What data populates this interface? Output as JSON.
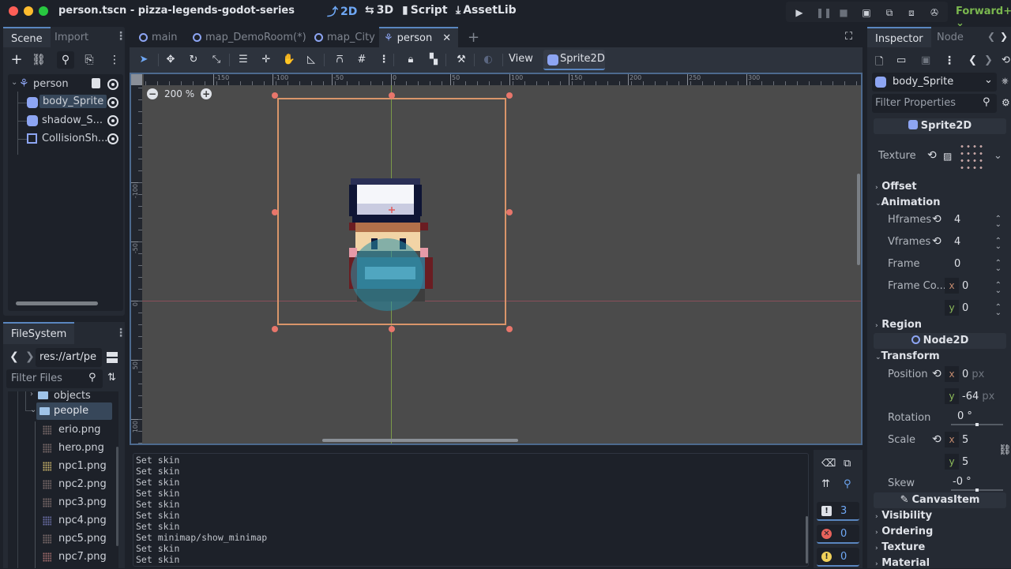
{
  "window": {
    "title": "person.tscn - pizza-legends-godot-series",
    "traffic_lights": [
      "#ff5f57",
      "#febc2e",
      "#28c840"
    ]
  },
  "workspaces": [
    {
      "label": "2D",
      "icon": "2d-icon",
      "active": true
    },
    {
      "label": "3D",
      "icon": "3d-icon",
      "active": false
    },
    {
      "label": "Script",
      "icon": "script-icon",
      "active": false
    },
    {
      "label": "AssetLib",
      "icon": "download-icon",
      "active": false
    }
  ],
  "run_bar": {
    "buttons": [
      "play",
      "pause",
      "stop",
      "remote-debug",
      "run-current-scene",
      "run-specific-scene",
      "movie-maker"
    ],
    "renderer": "Forward+"
  },
  "scene_dock": {
    "tabs": [
      "Scene",
      "Import"
    ],
    "active_tab": "Scene",
    "tree": [
      {
        "label": "person",
        "type": "Node2D",
        "depth": 0,
        "has_script": true
      },
      {
        "label": "body_Sprite",
        "type": "Sprite2D",
        "depth": 1,
        "selected": true
      },
      {
        "label": "shadow_S...",
        "type": "Sprite2D",
        "depth": 1
      },
      {
        "label": "CollisionSh...",
        "type": "CollisionShape2D",
        "depth": 1
      }
    ]
  },
  "filesystem": {
    "tab": "FileSystem",
    "path": "res://art/pe",
    "filter_placeholder": "Filter Files",
    "folders": [
      {
        "label": "objects",
        "expanded": false
      },
      {
        "label": "people",
        "expanded": true,
        "selected": true
      }
    ],
    "files": [
      "erio.png",
      "hero.png",
      "npc1.png",
      "npc2.png",
      "npc3.png",
      "npc4.png",
      "npc5.png",
      "npc7.png"
    ]
  },
  "scene_tabs": [
    {
      "label": "main",
      "active": false
    },
    {
      "label": "map_DemoRoom(*)",
      "active": false
    },
    {
      "label": "map_City",
      "active": false
    },
    {
      "label": "person",
      "active": true,
      "closable": true
    }
  ],
  "viewport_toolbar": {
    "view_label": "View",
    "node_menu_label": "Sprite2D"
  },
  "viewport": {
    "zoom": "200 %",
    "h_ruler_labels": [
      "-150",
      "-100",
      "-50",
      "0",
      "50",
      "100",
      "150",
      "200",
      "250",
      "300"
    ],
    "v_ruler_labels": [
      "-100",
      "-50",
      "0",
      "50",
      "100"
    ]
  },
  "output": {
    "lines": [
      "Set skin",
      "Set skin",
      "Set skin",
      "Set skin",
      "Set skin",
      "Set skin",
      "Set skin",
      "Set minimap/show_minimap",
      "Set skin",
      "Set skin"
    ],
    "counts": {
      "messages": "3",
      "errors": "0",
      "warnings": "0"
    }
  },
  "inspector": {
    "tabs": [
      "Inspector",
      "Node"
    ],
    "active_tab": "Inspector",
    "object_name": "body_Sprite",
    "filter_placeholder": "Filter Properties",
    "class_sprite": "Sprite2D",
    "texture_label": "Texture",
    "groups": {
      "offset": "Offset",
      "animation": "Animation",
      "region": "Region",
      "transform": "Transform",
      "visibility": "Visibility",
      "ordering": "Ordering",
      "texture": "Texture",
      "material": "Material"
    },
    "animation": {
      "hframes_label": "Hframes",
      "hframes": "4",
      "vframes_label": "Vframes",
      "vframes": "4",
      "frame_label": "Frame",
      "frame": "0",
      "frame_coords_label": "Frame Co...",
      "frame_coords_x": "0",
      "frame_coords_y": "0"
    },
    "class_node2d": "Node2D",
    "transform": {
      "position_label": "Position",
      "position_x": "0",
      "position_y": "-64",
      "unit": "px",
      "rotation_label": "Rotation",
      "rotation": "0 °",
      "scale_label": "Scale",
      "scale_x": "5",
      "scale_y": "5",
      "skew_label": "Skew",
      "skew": "-0 °"
    },
    "class_canvasitem": "CanvasItem"
  }
}
